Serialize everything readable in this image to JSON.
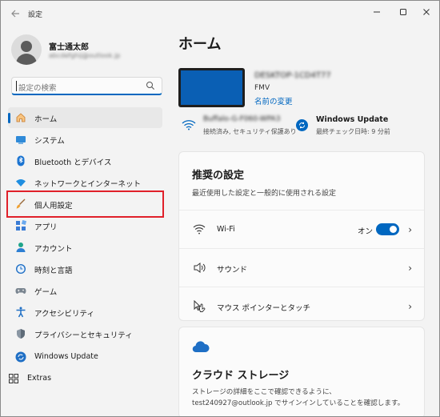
{
  "window": {
    "title": "設定"
  },
  "profile": {
    "name": "富士通太郎",
    "email": "abcdefghij@outlook.jp"
  },
  "search": {
    "placeholder": "設定の検索"
  },
  "sidebar": {
    "items": [
      {
        "label": "ホーム",
        "icon": "home-icon"
      },
      {
        "label": "システム",
        "icon": "system-icon"
      },
      {
        "label": "Bluetooth とデバイス",
        "icon": "bluetooth-icon"
      },
      {
        "label": "ネットワークとインターネット",
        "icon": "network-icon"
      },
      {
        "label": "個人用設定",
        "icon": "brush-icon"
      },
      {
        "label": "アプリ",
        "icon": "apps-icon"
      },
      {
        "label": "アカウント",
        "icon": "account-icon"
      },
      {
        "label": "時刻と言語",
        "icon": "time-language-icon"
      },
      {
        "label": "ゲーム",
        "icon": "gamepad-icon"
      },
      {
        "label": "アクセシビリティ",
        "icon": "accessibility-icon"
      },
      {
        "label": "プライバシーとセキュリティ",
        "icon": "shield-icon"
      },
      {
        "label": "Windows Update",
        "icon": "update-icon"
      },
      {
        "label": "Extras",
        "icon": "extras-icon"
      }
    ]
  },
  "main": {
    "title": "ホーム",
    "device": {
      "name": "DESKTOP-1CD4T77",
      "model": "FMV",
      "rename_link": "名前の変更"
    },
    "network": {
      "name": "Buffalo-G-F060-WPA3",
      "status": "接続済み, セキュリティ保護あり"
    },
    "update": {
      "title": "Windows Update",
      "status": "最終チェック日時: 9 分前"
    },
    "recommended": {
      "title": "推奨の設定",
      "subtitle": "最近使用した設定と一般的に使用される設定",
      "rows": [
        {
          "label": "Wi-Fi",
          "toggle_label": "オン",
          "toggle_on": true
        },
        {
          "label": "サウンド"
        },
        {
          "label": "マウス ポインターとタッチ"
        }
      ]
    },
    "cloud": {
      "title": "クラウド ストレージ",
      "description": "ストレージの詳細をここで確認できるように、test240927@outlook.jp でサインインしていることを確認します。"
    }
  },
  "colors": {
    "accent": "#0067c0",
    "highlight_border": "#e0202a",
    "background": "#f3f3f3",
    "card": "#fbfbfb"
  }
}
